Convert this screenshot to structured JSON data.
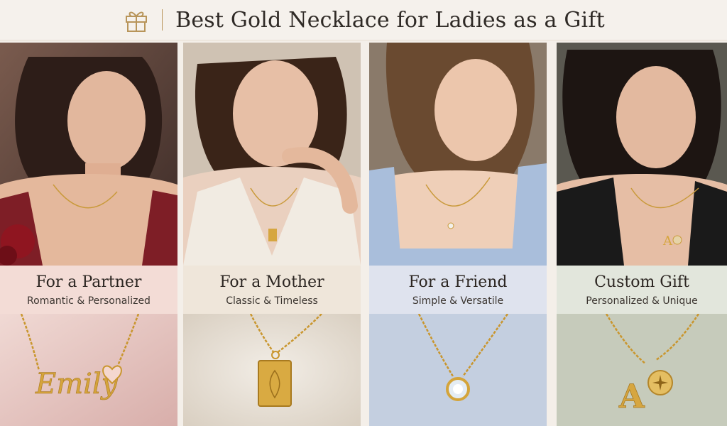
{
  "header": {
    "title": "Best Gold Necklace for Ladies as a Gift",
    "icon": "gift-icon",
    "accent": "#b8955a"
  },
  "cards": [
    {
      "title": "For a Partner",
      "subtitle": "Romantic & Personalized",
      "pendant_text": "Emily",
      "label_bg": "#f3dcd6",
      "product_bg": "#ead0cc"
    },
    {
      "title": "For a Mother",
      "subtitle": "Classic & Timeless",
      "label_bg": "#efe6da",
      "product_bg": "#e9e2d6"
    },
    {
      "title": "For a Friend",
      "subtitle": "Simple & Versatile",
      "label_bg": "#dfe3ee",
      "product_bg": "#c9d3e3"
    },
    {
      "title": "Custom Gift",
      "subtitle": "Personalized & Unique",
      "pendant_text": "A",
      "label_bg": "#e2e6dc",
      "product_bg": "#c9cebf"
    }
  ]
}
